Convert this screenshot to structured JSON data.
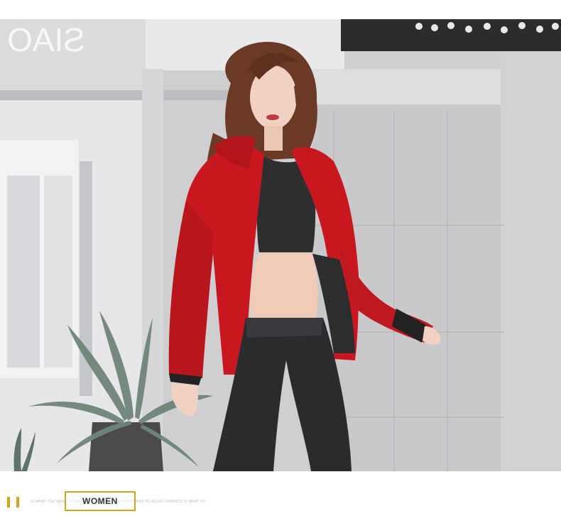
{
  "photo": {
    "alt": "",
    "storefront_sign": "SIAO"
  },
  "caption": {
    "tagline": "IS WHAT YOU WANT TO VELVET FABRICS IS WHAT YOU WANT TO VELVET FABRICS IS WHAT YO",
    "badge": "WOMEN"
  },
  "colors": {
    "accent": "#d9a21b",
    "jacket": "#c8171f",
    "leggings": "#2b2b2e",
    "wall": "#c9c9cb",
    "badge_text": "#333333"
  }
}
